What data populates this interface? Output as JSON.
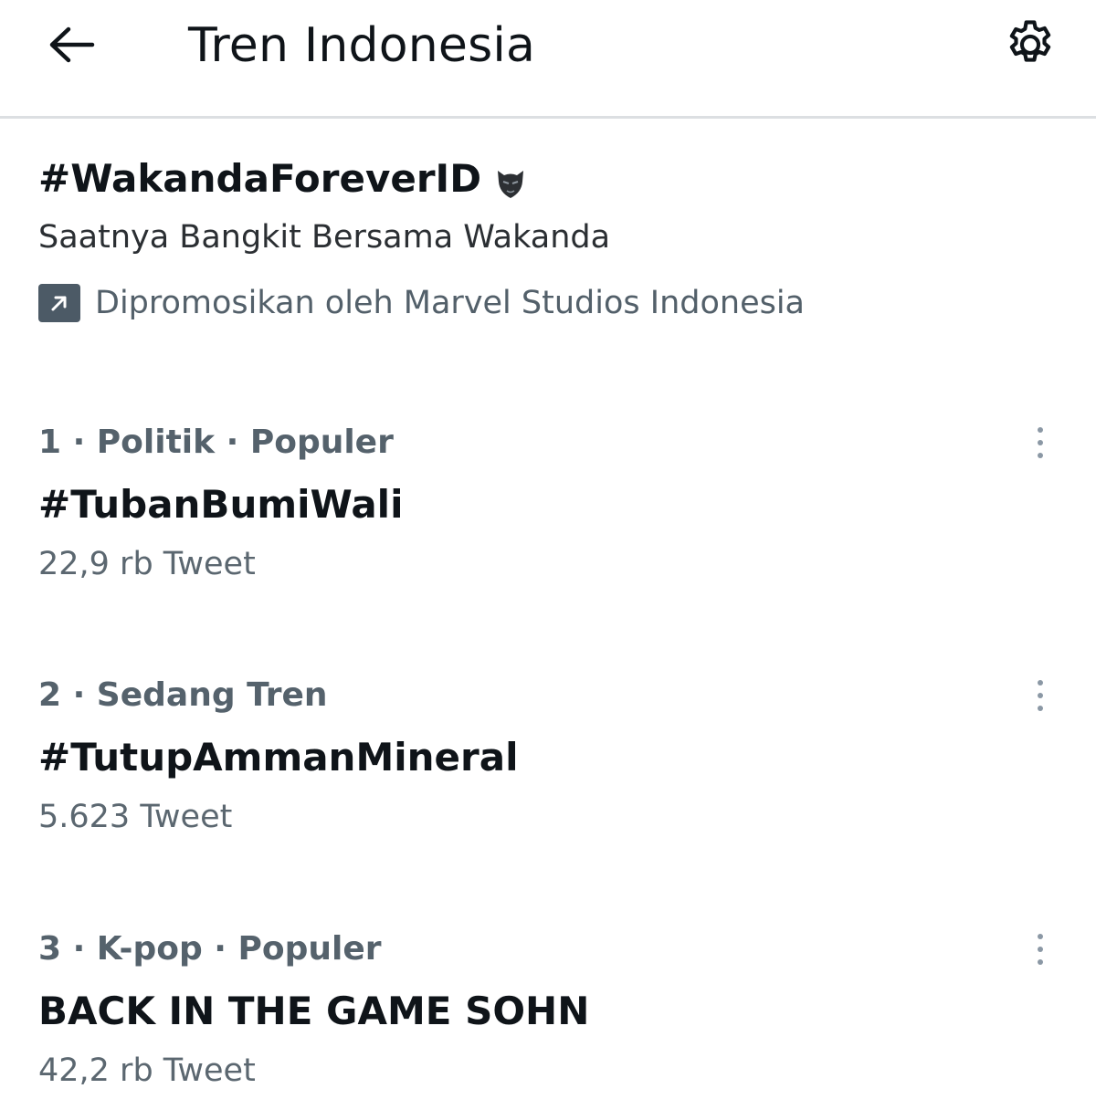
{
  "header": {
    "title": "Tren Indonesia",
    "back_icon": "arrow-left-icon",
    "settings_icon": "gear-icon"
  },
  "promoted": {
    "hashtag": "#WakandaForeverID",
    "emoji_icon": "black-panther-icon",
    "description": "Saatnya Bangkit Bersama Wakanda",
    "promoted_by": "Dipromosikan oleh Marvel Studios Indonesia",
    "promoted_icon": "promoted-arrow-icon"
  },
  "trends": [
    {
      "meta": "1 · Politik · Populer",
      "name": "#TubanBumiWali",
      "count": "22,9 rb Tweet"
    },
    {
      "meta": "2 · Sedang Tren",
      "name": "#TutupAmmanMineral",
      "count": "5.623 Tweet"
    },
    {
      "meta": "3 · K-pop · Populer",
      "name": "BACK IN THE GAME SOHN",
      "count": "42,2 rb Tweet"
    }
  ],
  "colors": {
    "text_primary": "#0f1419",
    "text_secondary": "#536471",
    "divider": "#dcdfe2"
  }
}
